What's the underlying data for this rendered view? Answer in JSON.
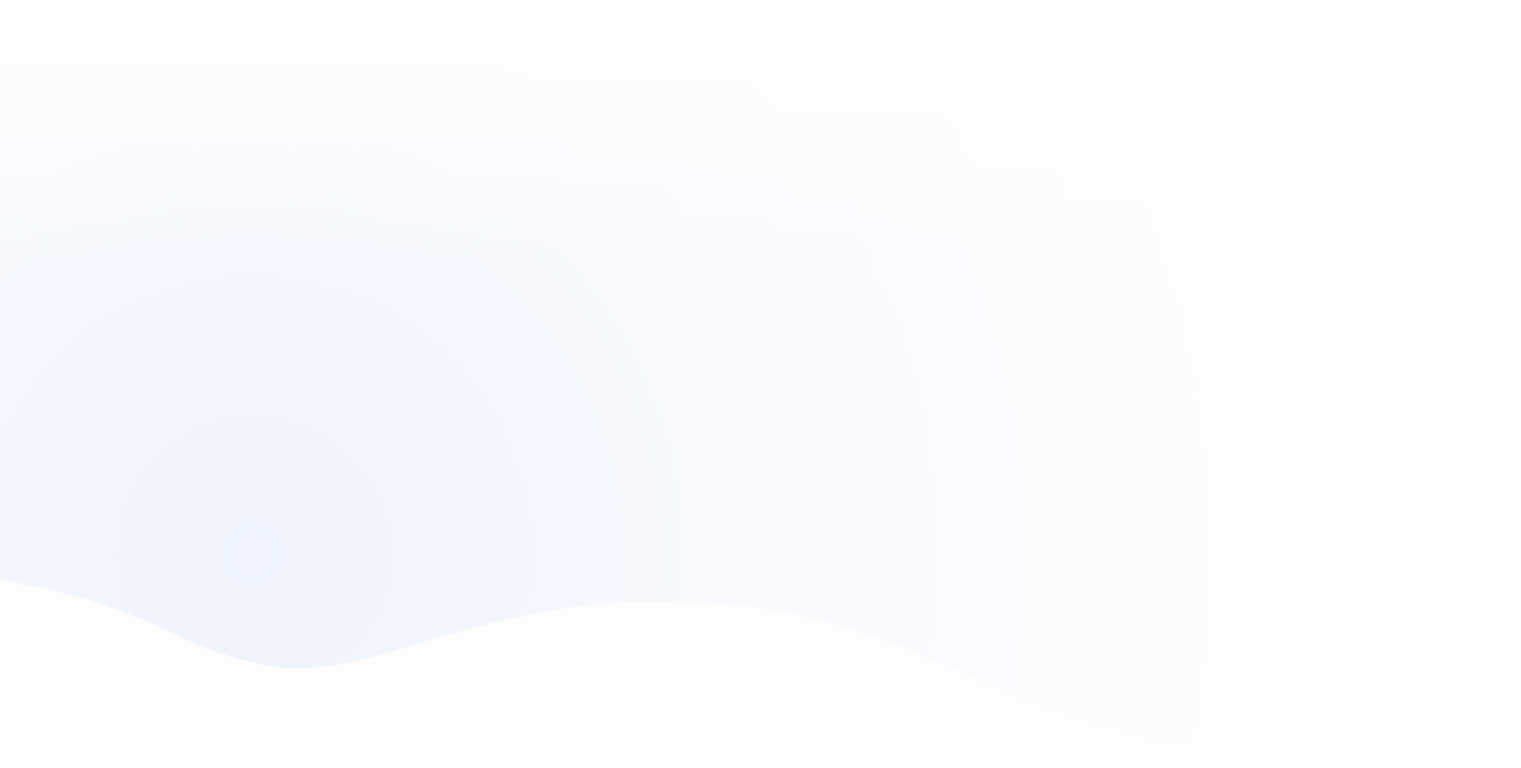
{
  "colors": {
    "page_background": "#fdfdfd",
    "gradient_tint": "#eef3fd",
    "gradient_mid": "#f7f9fe",
    "wave_fill": "#fdfdfd"
  }
}
